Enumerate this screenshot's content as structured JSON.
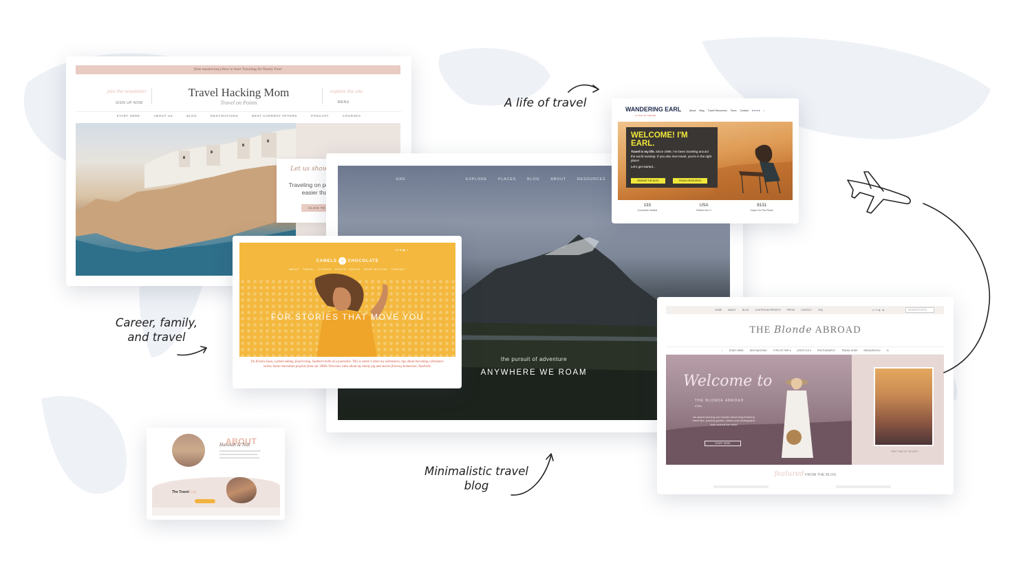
{
  "annotations": {
    "life_of_travel": "A life of travel",
    "career_family_travel_l1": "Career, family,",
    "career_family_travel_l2": "and travel",
    "minimalistic_l1": "Minimalistic travel",
    "minimalistic_l2": "blog"
  },
  "thm": {
    "banner": "[free masterclass] How to Start Traveling for Nearly Free!",
    "left_script": "join the newsletter",
    "left_label": "SIGN UP NOW",
    "title": "Travel Hacking Mom",
    "subtitle": "Travel on Points",
    "right_script": "explore the site",
    "right_label": "MENU",
    "nav": [
      "START HERE",
      "ABOUT US",
      "BLOG",
      "DESTINATIONS",
      "BEST CURRENT OFFERS",
      "PODCAST",
      "COURSES"
    ],
    "promo_script": "Let us show you the way.",
    "promo_text": "Traveling on points and miles is easier than you think.",
    "promo_button": "CLICK TO GET STARTED"
  },
  "arm": {
    "logo_fragment": "ERE",
    "nav": [
      "EXPLORE",
      "PLACES",
      "BLOG",
      "ABOUT",
      "RESOURCES"
    ],
    "tagline": "the pursuit of adventure",
    "title": "ANYWHERE WE ROAM"
  },
  "cc": {
    "logo_left": "CAMELS",
    "logo_right": "CHOCOLATE",
    "nav": "ABOUT · TRAVEL · STORIES · ROOTS · BOOKS · WORK WITH ME · CONTACT",
    "headline": "FOR STORIES THAT MOVE YOU",
    "bio": "I'm Kristin Luna, a photo-taking, food-loving, Southern belle of a journalist. This is where I share my adventures, tips about becoming a freelance writer, home renovation projects from our 1890s Victorian, tales about my ninety pig and stories from my hometown, Nashville"
  },
  "we": {
    "logo": "WANDERING EARL",
    "logo_sub": "A LIFE OF TRAVEL",
    "nav": [
      "About",
      "Blog",
      "Travel Resources",
      "Tours",
      "Contact"
    ],
    "welcome": "WELCOME! I'M EARL.",
    "intro_bold": "Travel is my life.",
    "intro": "Since 1999, I've been traveling around the world nonstop. If you also love travel, you're in the right place!",
    "cta": "Let's get started...",
    "btn1": "BROWSE THE BLOG",
    "btn2": "TRAVEL RESOURCES",
    "stats": [
      {
        "value": "133",
        "label": "Countries Visited"
      },
      {
        "value": "USA",
        "label": "Where Am I?"
      },
      {
        "value": "8131",
        "label": "Days On The Road"
      }
    ]
  },
  "tba": {
    "util_nav": [
      "HOME",
      "ABOUT",
      "BLOG",
      "LIGHTROOM PRESETS",
      "PRESS",
      "CONTACT",
      "FAQ"
    ],
    "search_placeholder": "SEARCH POSTS...",
    "logo_left": "THE",
    "logo_mid": "Blonde",
    "logo_right": "ABROAD",
    "nav": [
      "START HERE",
      "DESTINATIONS",
      "TYPE OF TRIP ▾",
      "LIFESTYLE ▾",
      "PHOTOGRAPHY",
      "TRAVEL SHOP",
      "RESOURCES ▾"
    ],
    "welcome": "Welcome to",
    "brand": "THE BLONDE ABROAD",
    "small": "#TBA",
    "desc": "An award-winning solo female travel blog featuring travel tips, packing guides, videos and photography from around the world",
    "start": "START HERE",
    "caption": "FIRST TIME TO THE SITE?",
    "feat_script": "featured",
    "feat_text": "FROM THE BLOG"
  },
  "about": {
    "title": "ABOUT",
    "script": "Hannah & Nat",
    "logo_script": "Life",
    "logo_bold": "The Travel"
  }
}
